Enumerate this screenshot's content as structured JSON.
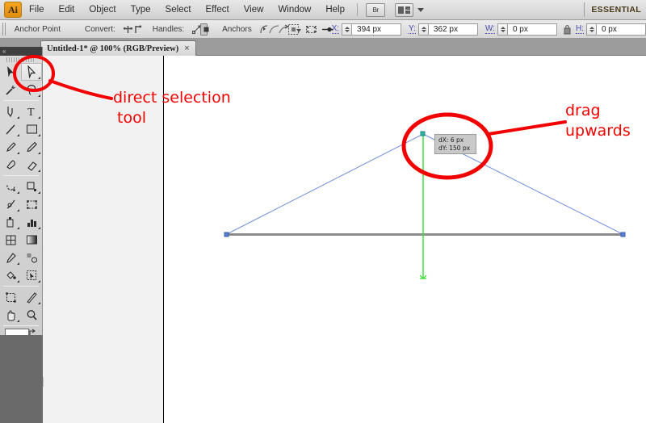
{
  "menubar": {
    "app_icon_label": "Ai",
    "items": [
      "File",
      "Edit",
      "Object",
      "Type",
      "Select",
      "Effect",
      "View",
      "Window",
      "Help"
    ],
    "bridge_label": "Br",
    "workspace_label": "ESSENTIAL"
  },
  "controlbar": {
    "anchor_point_label": "Anchor Point",
    "convert_label": "Convert:",
    "handles_label": "Handles:",
    "anchors_label": "Anchors",
    "fields": [
      {
        "label": "X:",
        "value": "394 px"
      },
      {
        "label": "Y:",
        "value": "362 px"
      },
      {
        "label": "W:",
        "value": "0 px"
      },
      {
        "label": "H:",
        "value": "0 px"
      }
    ]
  },
  "tabbar": {
    "document_title": "Untitled-1* @ 100% (RGB/Preview)",
    "close_glyph": "×"
  },
  "toolbox": {
    "selected_tool": "direct-selection-tool",
    "tools": [
      "selection-tool",
      "direct-selection-tool",
      "magic-wand-tool",
      "lasso-tool",
      "pen-tool",
      "type-tool",
      "line-segment-tool",
      "rectangle-tool",
      "paintbrush-tool",
      "pencil-tool",
      "blob-brush-tool",
      "eraser-tool",
      "rotate-tool",
      "scale-tool",
      "width-tool",
      "free-transform-tool",
      "symbol-sprayer-tool",
      "column-graph-tool",
      "mesh-tool",
      "gradient-tool",
      "eyedropper-tool",
      "blend-tool",
      "live-paint-bucket-tool",
      "live-paint-selection-tool",
      "artboard-tool",
      "slice-tool",
      "hand-tool",
      "zoom-tool"
    ],
    "fill_color": "#ffffff",
    "stroke_color": "#1a1a1a",
    "draw_modes": [
      "draw-normal",
      "draw-behind",
      "draw-inside"
    ],
    "screen_mode": "change-screen-mode"
  },
  "annotations": {
    "tool_note_line1": "direct selection",
    "tool_note_line2": "tool",
    "drag_note_line1": "drag",
    "drag_note_line2": "upwards",
    "ink_color": "#f20000"
  },
  "canvas": {
    "tooltip": {
      "dx_label": "dX:",
      "dx_value": "6 px",
      "dy_label": "dY:",
      "dy_value": "150 px"
    },
    "path_color": "#6f8fd8",
    "baseline_color": "#8c8c8c",
    "smart_guide_color": "#35e035",
    "anchor_color": "#2bb3a8",
    "shape": "triangle-being-edited"
  }
}
